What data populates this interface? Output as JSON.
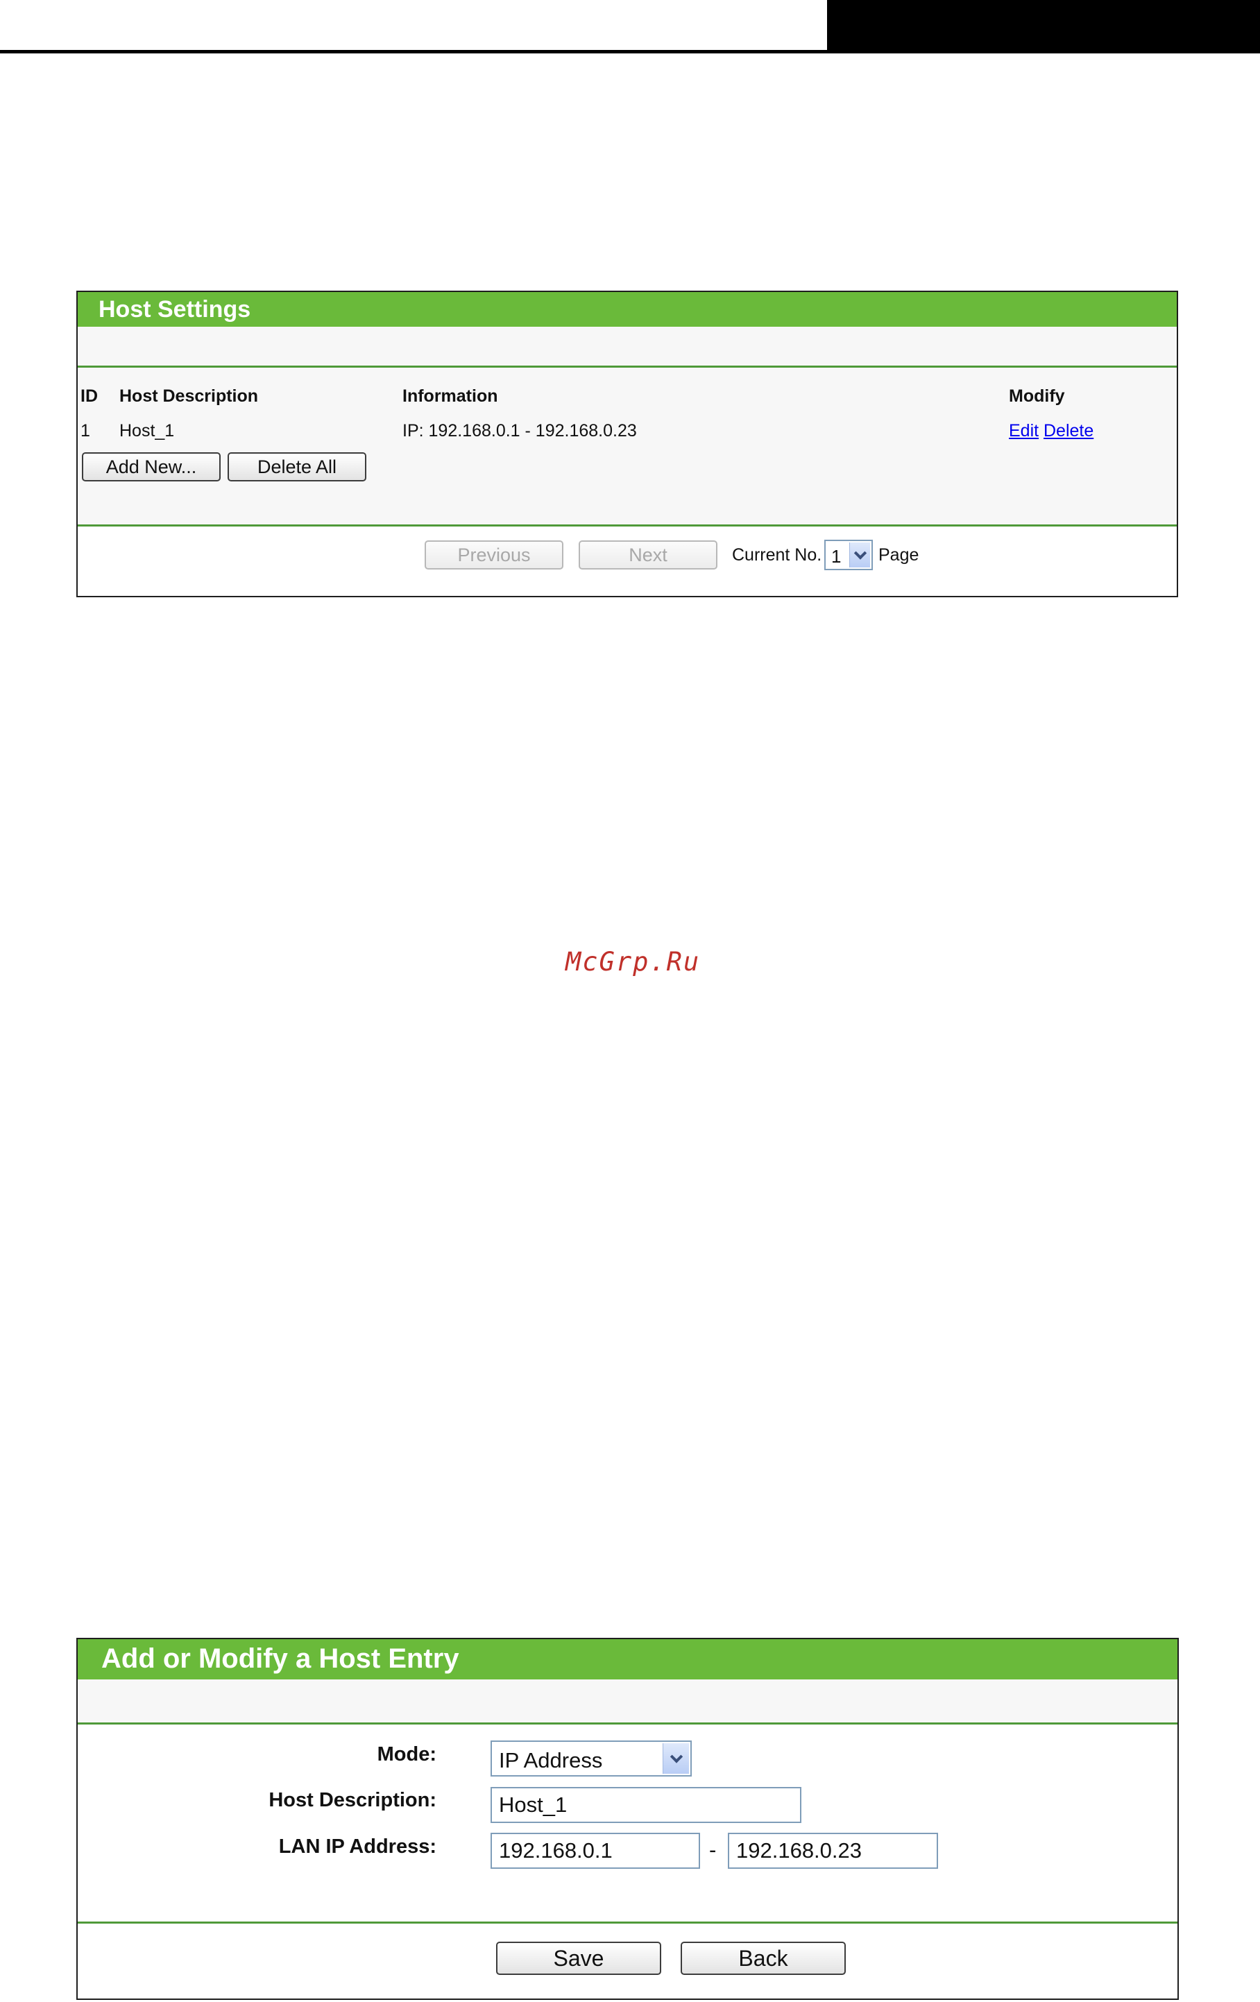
{
  "host_settings": {
    "title": "Host Settings",
    "columns": {
      "id": "ID",
      "description": "Host Description",
      "information": "Information",
      "modify": "Modify"
    },
    "rows": [
      {
        "id": "1",
        "description": "Host_1",
        "information": "IP: 192.168.0.1 - 192.168.0.23",
        "edit": "Edit",
        "delete": "Delete"
      }
    ],
    "add_new_label": "Add New...",
    "delete_all_label": "Delete All",
    "previous_label": "Previous",
    "next_label": "Next",
    "current_no_label": "Current No.",
    "current_page": "1",
    "page_label": "Page"
  },
  "watermark": "McGrp.Ru",
  "host_entry": {
    "title": "Add or Modify a Host Entry",
    "mode_label": "Mode:",
    "mode_value": "IP Address",
    "description_label": "Host Description:",
    "description_value": "Host_1",
    "lan_ip_label": "LAN IP Address:",
    "ip_start": "192.168.0.1",
    "ip_separator": "-",
    "ip_end": "192.168.0.23",
    "save_label": "Save",
    "back_label": "Back"
  },
  "colors": {
    "header_green": "#6aba3a",
    "separator_green": "#4f9a39",
    "link_blue": "#0000ee"
  }
}
